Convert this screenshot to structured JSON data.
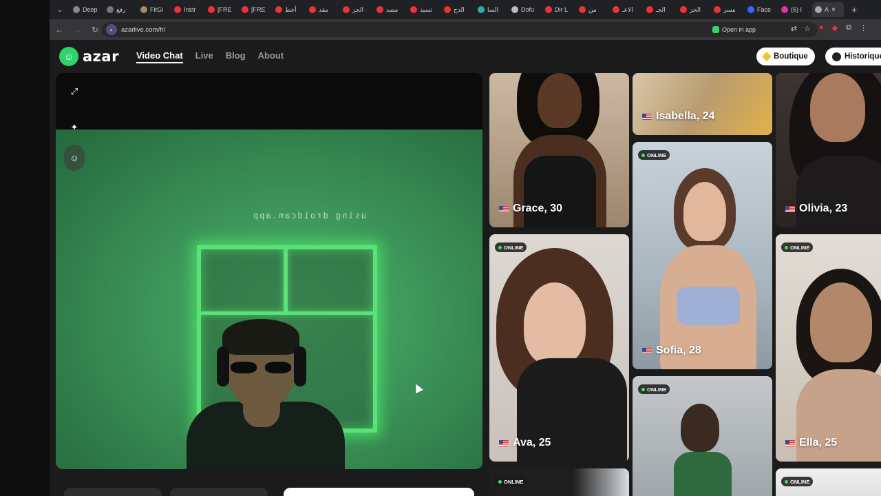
{
  "browser": {
    "tabs": [
      {
        "label": "Deep",
        "color": "#888"
      },
      {
        "label": "رفع",
        "color": "#777"
      },
      {
        "label": "FitGi",
        "color": "#a86"
      },
      {
        "label": "Instr",
        "color": "#e33"
      },
      {
        "label": "[FRE",
        "color": "#e33"
      },
      {
        "label": "[FRE",
        "color": "#e33"
      },
      {
        "label": "أخط",
        "color": "#e33"
      },
      {
        "label": "مقد",
        "color": "#e33"
      },
      {
        "label": "الجز",
        "color": "#e33"
      },
      {
        "label": "مصد",
        "color": "#e33"
      },
      {
        "label": "تسيد",
        "color": "#e33"
      },
      {
        "label": "الدح",
        "color": "#e33"
      },
      {
        "label": "السا",
        "color": "#3aa"
      },
      {
        "label": "Dofu",
        "color": "#bbb"
      },
      {
        "label": "Dir L",
        "color": "#e33"
      },
      {
        "label": "من",
        "color": "#e33"
      },
      {
        "label": "الاعـ",
        "color": "#e33"
      },
      {
        "label": "الجـ",
        "color": "#e33"
      },
      {
        "label": "الجز",
        "color": "#e33"
      },
      {
        "label": "مسر",
        "color": "#e33"
      },
      {
        "label": "Face",
        "color": "#36f"
      },
      {
        "label": "(6) I",
        "color": "#d3a"
      },
      {
        "label": "A",
        "color": "#aaa"
      }
    ],
    "url": "azarlive.com/fr/",
    "open_in_app": "Open in app"
  },
  "header": {
    "logo_text": "azar",
    "nav": [
      {
        "label": "Video Chat",
        "active": true
      },
      {
        "label": "Live",
        "active": false
      },
      {
        "label": "Blog",
        "active": false
      },
      {
        "label": "About",
        "active": false
      }
    ],
    "shop_label": "Boutique",
    "history_label": "Historique",
    "shop_icon_color": "#f2c230"
  },
  "video": {
    "watermark": "using droidcam.app"
  },
  "profiles": [
    {
      "name": "Grace, 30",
      "online": false,
      "bg": "#c9b8a6"
    },
    {
      "name": "Isabella, 24",
      "online": false,
      "bg": "#c8a879"
    },
    {
      "name": "Olivia, 23",
      "online": false,
      "bg": "#463a36"
    },
    {
      "name": "Sofia, 28",
      "online": true,
      "bg": "#b7c3cd"
    },
    {
      "name": "Ava, 25",
      "online": true,
      "bg": "#d9d4cf"
    },
    {
      "name": "Ella, 25",
      "online": true,
      "bg": "#d8d0c4"
    },
    {
      "name": "",
      "online": true,
      "bg": "#2a2a2a"
    },
    {
      "name": "",
      "online": true,
      "bg": "#c5c8ca"
    },
    {
      "name": "",
      "online": true,
      "bg": "#ececec"
    }
  ],
  "online_label": "ONLINE"
}
